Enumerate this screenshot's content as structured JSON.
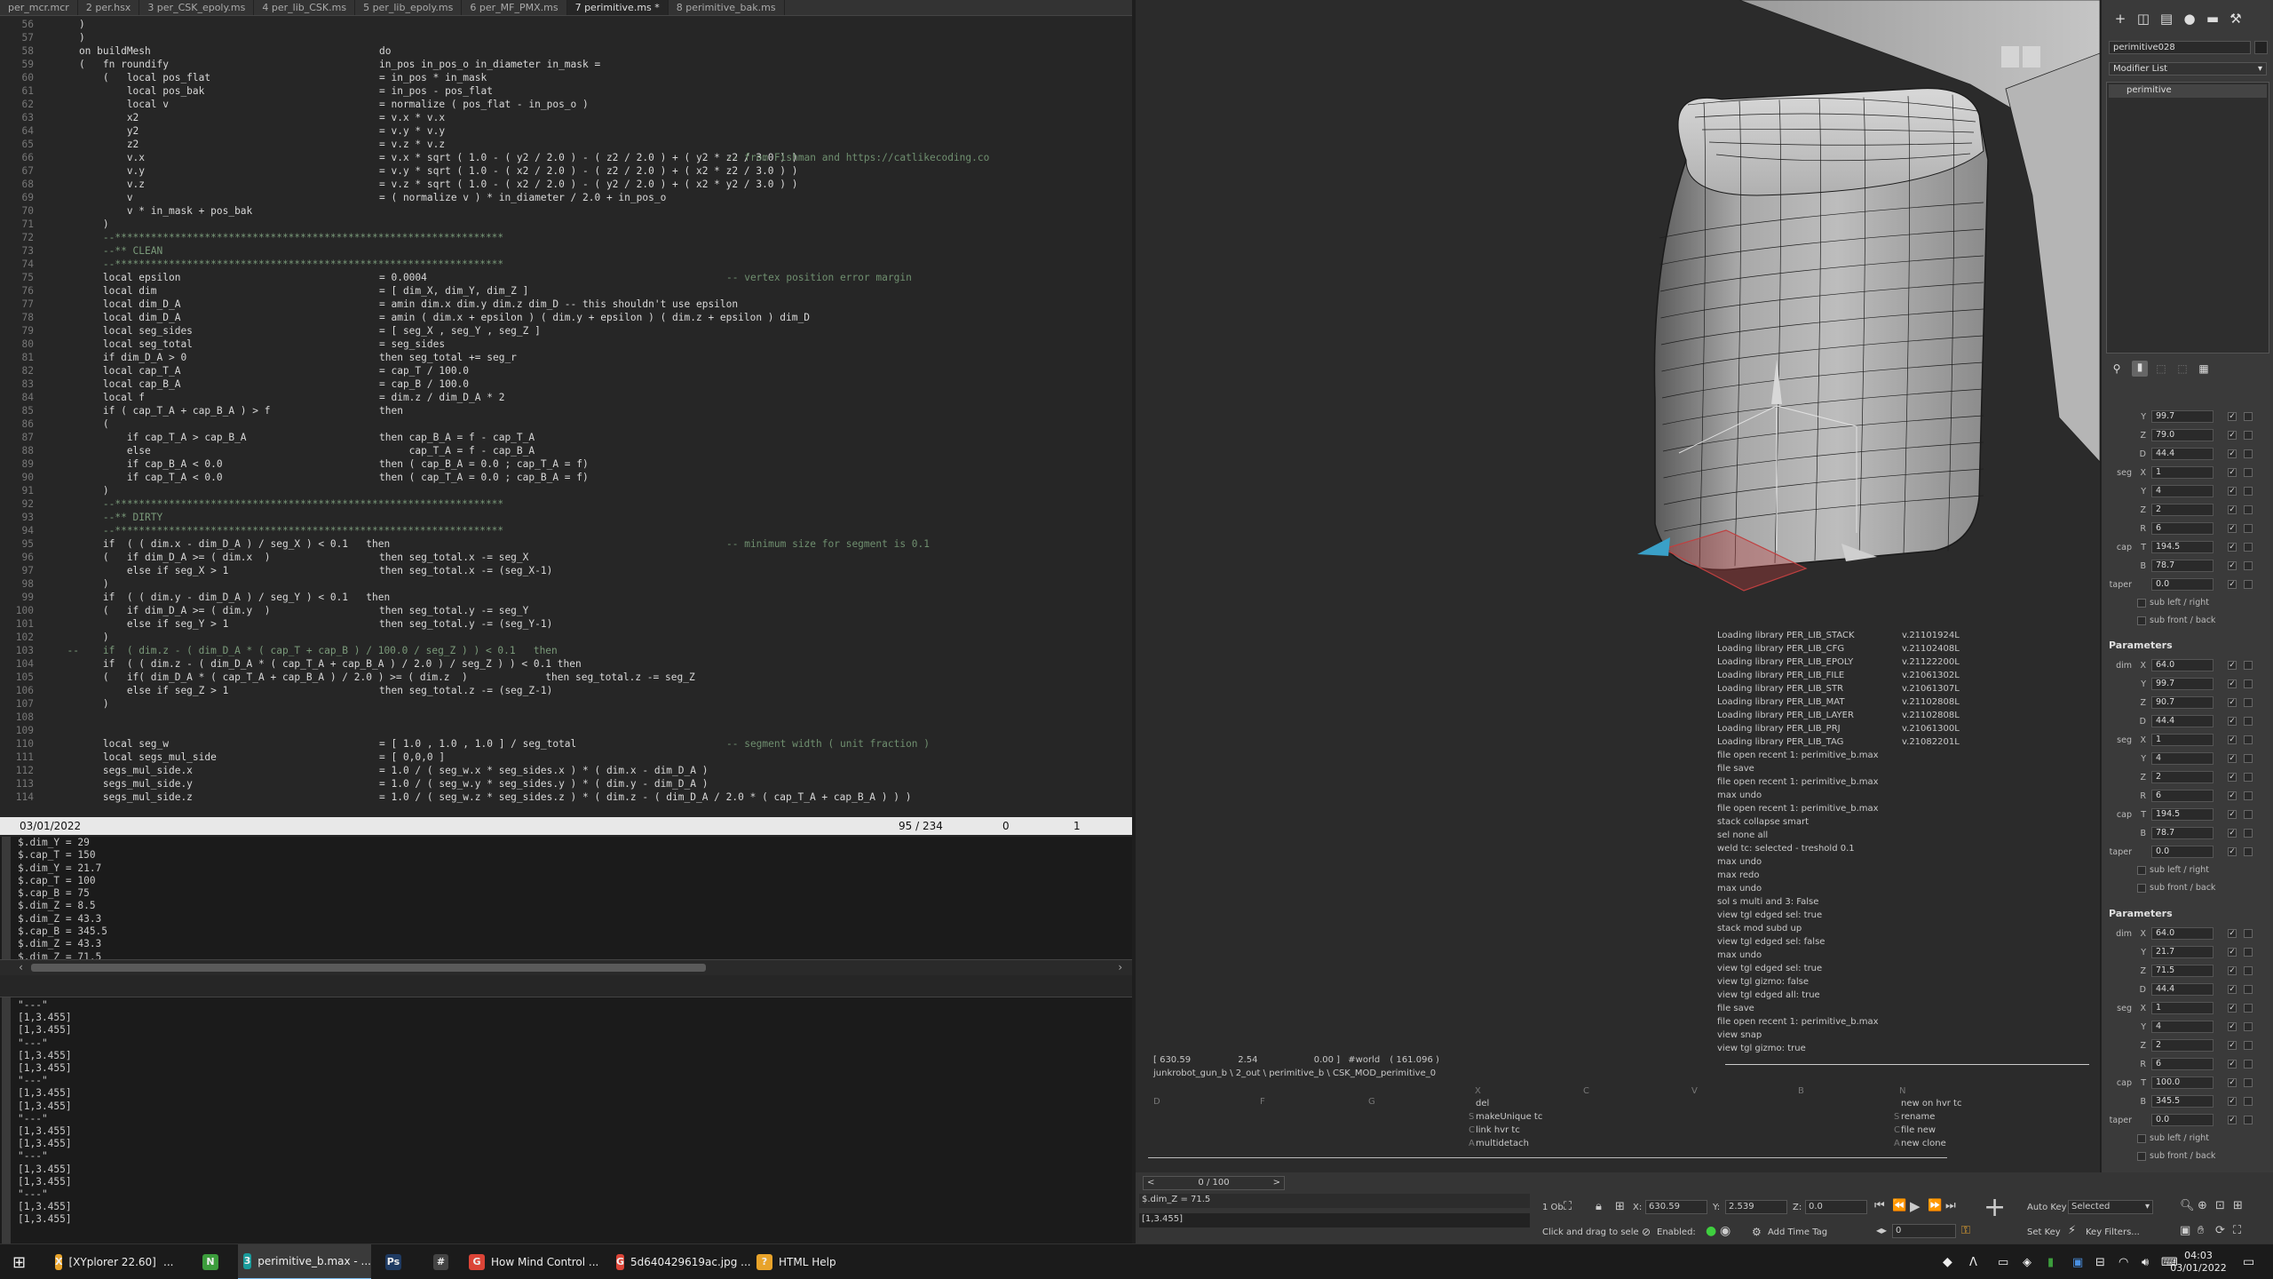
{
  "editor": {
    "tabs": [
      {
        "label": "per_mcr.mcr",
        "active": false
      },
      {
        "label": "2 per.hsx",
        "active": false
      },
      {
        "label": "3 per_CSK_epoly.ms",
        "active": false
      },
      {
        "label": "4 per_lib_CSK.ms",
        "active": false
      },
      {
        "label": "5 per_lib_epoly.ms",
        "active": false
      },
      {
        "label": "6 per_MF_PMX.ms",
        "active": false
      },
      {
        "label": "7 perimitive.ms *",
        "active": true
      },
      {
        "label": "8 perimitive_bak.ms",
        "active": false
      }
    ],
    "lines": [
      {
        "n": "56",
        "t": "    )",
        "r": "",
        "c": ""
      },
      {
        "n": "57",
        "t": "    )",
        "r": "",
        "c": ""
      },
      {
        "n": "58",
        "t": "    on buildMesh",
        "r": "do",
        "c": ""
      },
      {
        "n": "59",
        "t": "    (   fn roundify",
        "r": "in_pos in_pos_o in_diameter in_mask =",
        "c": ""
      },
      {
        "n": "60",
        "t": "        (   local pos_flat",
        "r": "= in_pos * in_mask",
        "c": ""
      },
      {
        "n": "61",
        "t": "            local pos_bak",
        "r": "= in_pos - pos_flat",
        "c": ""
      },
      {
        "n": "62",
        "t": "            local v",
        "r": "= normalize ( pos_flat - in_pos_o )",
        "c": ""
      },
      {
        "n": "63",
        "t": "            x2",
        "r": "= v.x * v.x",
        "c": ""
      },
      {
        "n": "64",
        "t": "            y2",
        "r": "= v.y * v.y",
        "c": ""
      },
      {
        "n": "65",
        "t": "            z2",
        "r": "= v.z * v.z",
        "c": ""
      },
      {
        "n": "66",
        "t": "            v.x",
        "r": "= v.x * sqrt ( 1.0 - ( y2 / 2.0 ) - ( z2 / 2.0 ) + ( y2 * z2 / 3.0 ) )",
        "c": "-- from Fishman and https://catlikecoding.co"
      },
      {
        "n": "67",
        "t": "            v.y",
        "r": "= v.y * sqrt ( 1.0 - ( x2 / 2.0 ) - ( z2 / 2.0 ) + ( x2 * z2 / 3.0 ) )",
        "c": ""
      },
      {
        "n": "68",
        "t": "            v.z",
        "r": "= v.z * sqrt ( 1.0 - ( x2 / 2.0 ) - ( y2 / 2.0 ) + ( x2 * y2 / 3.0 ) )",
        "c": ""
      },
      {
        "n": "69",
        "t": "            v",
        "r": "= ( normalize v ) * in_diameter / 2.0 + in_pos_o",
        "c": ""
      },
      {
        "n": "70",
        "t": "            v * in_mask + pos_bak",
        "r": "",
        "c": ""
      },
      {
        "n": "71",
        "t": "        )",
        "r": "",
        "c": ""
      },
      {
        "n": "72",
        "t": "        --*****************************************************************",
        "r": "",
        "c": ""
      },
      {
        "n": "73",
        "t": "        --** CLEAN",
        "r": "",
        "c": ""
      },
      {
        "n": "74",
        "t": "        --*****************************************************************",
        "r": "",
        "c": ""
      },
      {
        "n": "75",
        "t": "        local epsilon",
        "r": "= 0.0004",
        "c": "-- vertex position error margin"
      },
      {
        "n": "76",
        "t": "        local dim",
        "r": "= [ dim_X, dim_Y, dim_Z ]",
        "c": ""
      },
      {
        "n": "77",
        "t": "        local dim_D_A",
        "r": "= amin dim.x dim.y dim.z dim_D -- this shouldn't use epsilon",
        "c": ""
      },
      {
        "n": "78",
        "t": "        local dim_D_A",
        "r": "= amin ( dim.x + epsilon ) ( dim.y + epsilon ) ( dim.z + epsilon ) dim_D",
        "c": ""
      },
      {
        "n": "79",
        "t": "        local seg_sides",
        "r": "= [ seg_X , seg_Y , seg_Z ]",
        "c": ""
      },
      {
        "n": "80",
        "t": "        local seg_total",
        "r": "= seg_sides",
        "c": ""
      },
      {
        "n": "81",
        "t": "        if dim_D_A > 0",
        "r": "then seg_total += seg_r",
        "c": ""
      },
      {
        "n": "82",
        "t": "        local cap_T_A",
        "r": "= cap_T / 100.0",
        "c": ""
      },
      {
        "n": "83",
        "t": "        local cap_B_A",
        "r": "= cap_B / 100.0",
        "c": ""
      },
      {
        "n": "84",
        "t": "        local f",
        "r": "= dim.z / dim_D_A * 2",
        "c": ""
      },
      {
        "n": "85",
        "t": "        if ( cap_T_A + cap_B_A ) > f",
        "r": "then",
        "c": ""
      },
      {
        "n": "86",
        "t": "        (",
        "r": "",
        "c": ""
      },
      {
        "n": "87",
        "t": "            if cap_T_A > cap_B_A",
        "r": "then cap_B_A = f - cap_T_A",
        "c": ""
      },
      {
        "n": "88",
        "t": "            else",
        "r": "     cap_T_A = f - cap_B_A",
        "c": ""
      },
      {
        "n": "89",
        "t": "            if cap_B_A < 0.0",
        "r": "then ( cap_B_A = 0.0 ; cap_T_A = f)",
        "c": ""
      },
      {
        "n": "90",
        "t": "            if cap_T_A < 0.0",
        "r": "then ( cap_T_A = 0.0 ; cap_B_A = f)",
        "c": ""
      },
      {
        "n": "91",
        "t": "        )",
        "r": "",
        "c": ""
      },
      {
        "n": "92",
        "t": "        --*****************************************************************",
        "r": "",
        "c": ""
      },
      {
        "n": "93",
        "t": "        --** DIRTY",
        "r": "",
        "c": ""
      },
      {
        "n": "94",
        "t": "        --*****************************************************************",
        "r": "",
        "c": ""
      },
      {
        "n": "95",
        "t": "        if  ( ( dim.x - dim_D_A ) / seg_X ) < 0.1   then",
        "r": "",
        "c": "-- minimum size for segment is 0.1"
      },
      {
        "n": "96",
        "t": "        (   if dim_D_A >= ( dim.x  )",
        "r": "then seg_total.x -= seg_X",
        "c": ""
      },
      {
        "n": "97",
        "t": "            else if seg_X > 1",
        "r": "then seg_total.x -= (seg_X-1)",
        "c": ""
      },
      {
        "n": "98",
        "t": "        )",
        "r": "",
        "c": ""
      },
      {
        "n": "99",
        "t": "        if  ( ( dim.y - dim_D_A ) / seg_Y ) < 0.1   then",
        "r": "",
        "c": ""
      },
      {
        "n": "100",
        "t": "        (   if dim_D_A >= ( dim.y  )",
        "r": "then seg_total.y -= seg_Y",
        "c": ""
      },
      {
        "n": "101",
        "t": "            else if seg_Y > 1",
        "r": "then seg_total.y -= (seg_Y-1)",
        "c": ""
      },
      {
        "n": "102",
        "t": "        )",
        "r": "",
        "c": ""
      },
      {
        "n": "103",
        "t": "  --    if  ( dim.z - ( dim_D_A * ( cap_T + cap_B ) / 100.0 / seg_Z ) ) < 0.1   then",
        "r": "",
        "c": ""
      },
      {
        "n": "104",
        "t": "        if  ( ( dim.z - ( dim_D_A * ( cap_T_A + cap_B_A ) / 2.0 ) / seg_Z ) ) < 0.1 then",
        "r": "",
        "c": ""
      },
      {
        "n": "105",
        "t": "        (   if( dim_D_A * ( cap_T_A + cap_B_A ) / 2.0 ) >= ( dim.z  )             then seg_total.z -= seg_Z",
        "r": "",
        "c": ""
      },
      {
        "n": "106",
        "t": "            else if seg_Z > 1",
        "r": "then seg_total.z -= (seg_Z-1)",
        "c": ""
      },
      {
        "n": "107",
        "t": "        )",
        "r": "",
        "c": ""
      },
      {
        "n": "108",
        "t": "",
        "r": "",
        "c": ""
      },
      {
        "n": "109",
        "t": "",
        "r": "",
        "c": ""
      },
      {
        "n": "110",
        "t": "        local seg_w",
        "r": "= [ 1.0 , 1.0 , 1.0 ] / seg_total",
        "c": "-- segment width ( unit fraction )"
      },
      {
        "n": "111",
        "t": "        local segs_mul_side",
        "r": "= [ 0,0,0 ]",
        "c": ""
      },
      {
        "n": "112",
        "t": "        segs_mul_side.x",
        "r": "= 1.0 / ( seg_w.x * seg_sides.x ) * ( dim.x - dim_D_A )",
        "c": ""
      },
      {
        "n": "113",
        "t": "        segs_mul_side.y",
        "r": "= 1.0 / ( seg_w.y * seg_sides.y ) * ( dim.y - dim_D_A )",
        "c": ""
      },
      {
        "n": "114",
        "t": "        segs_mul_side.z",
        "r": "= 1.0 / ( seg_w.z * seg_sides.z ) * ( dim.z - ( dim_D_A / 2.0 * ( cap_T_A + cap_B_A ) ) )",
        "c": ""
      }
    ],
    "status": {
      "date": "03/01/2022",
      "position": "95 / 234",
      "col": "0",
      "sel": "1"
    },
    "listener_top": [
      "$.dim_Y = 29",
      "$.cap_T = 150",
      "$.dim_Y = 21.7",
      "$.cap_T = 100",
      "$.cap_B = 75",
      "$.dim_Z = 8.5",
      "$.dim_Z = 43.3",
      "$.cap_B = 345.5",
      "$.dim_Z = 43.3",
      "$.dim_Z = 71.5"
    ],
    "listener_bottom": [
      "\"---\"",
      "[1,3.455]",
      "[1,3.455]",
      "\"---\"",
      "[1,3.455]",
      "[1,3.455]",
      "\"---\"",
      "[1,3.455]",
      "[1,3.455]",
      "\"---\"",
      "[1,3.455]",
      "[1,3.455]",
      "\"---\"",
      "[1,3.455]",
      "[1,3.455]",
      "\"---\"",
      "[1,3.455]",
      "[1,3.455]"
    ]
  },
  "viewport": {
    "log": [
      {
        "text": "Loading library PER_LIB_STACK",
        "ver": "v.21101924L"
      },
      {
        "text": "Loading library PER_LIB_CFG",
        "ver": "v.21102408L"
      },
      {
        "text": "Loading library PER_LIB_EPOLY",
        "ver": "v.21122200L"
      },
      {
        "text": "Loading library PER_LIB_FILE",
        "ver": "v.21061302L"
      },
      {
        "text": "Loading library PER_LIB_STR",
        "ver": "v.21061307L"
      },
      {
        "text": "Loading library PER_LIB_MAT",
        "ver": "v.21102808L"
      },
      {
        "text": "Loading library PER_LIB_LAYER",
        "ver": "v.21102808L"
      },
      {
        "text": "Loading library PER_LIB_PRJ",
        "ver": "v.21061300L"
      },
      {
        "text": "Loading library PER_LIB_TAG",
        "ver": "v.21082201L"
      },
      {
        "text": "file open recent 1: perimitive_b.max",
        "ver": ""
      },
      {
        "text": "file save",
        "ver": ""
      },
      {
        "text": "file open recent 1: perimitive_b.max",
        "ver": ""
      },
      {
        "text": "max undo",
        "ver": ""
      },
      {
        "text": "file open recent 1: perimitive_b.max",
        "ver": ""
      },
      {
        "text": "stack collapse smart",
        "ver": ""
      },
      {
        "text": "sel none all",
        "ver": ""
      },
      {
        "text": "weld tc: selected - treshold 0.1",
        "ver": ""
      },
      {
        "text": "max undo",
        "ver": ""
      },
      {
        "text": "max redo",
        "ver": ""
      },
      {
        "text": "max undo",
        "ver": ""
      },
      {
        "text": "sol s multi and 3: False",
        "ver": ""
      },
      {
        "text": "view tgl edged sel: true",
        "ver": ""
      },
      {
        "text": "stack mod subd up",
        "ver": ""
      },
      {
        "text": "view tgl edged sel: false",
        "ver": ""
      },
      {
        "text": "max undo",
        "ver": ""
      },
      {
        "text": "view tgl edged sel: true",
        "ver": ""
      },
      {
        "text": "view tgl gizmo: false",
        "ver": ""
      },
      {
        "text": "view tgl edged all: true",
        "ver": ""
      },
      {
        "text": "file save",
        "ver": ""
      },
      {
        "text": "file open recent 1: perimitive_b.max",
        "ver": ""
      },
      {
        "text": "view snap",
        "ver": ""
      },
      {
        "text": "view tgl gizmo: true",
        "ver": ""
      }
    ],
    "coord_x": "[ 630.59",
    "coord_y": "2.54",
    "coord_z": "0.00 ]",
    "coord_space": "#world",
    "coord_len": "( 161.096 )",
    "path": "junkrobot_gun_b \\ 2_out \\ perimitive_b \\ CSK_MOD_perimitive_0",
    "hotkey_headers": [
      "X",
      "C",
      "V",
      "B",
      "N",
      "D",
      "F",
      "G"
    ],
    "hotkeys_left": [
      "del",
      "makeUnique tc",
      "link hvr tc",
      "multidetach"
    ],
    "hotkeys_left_keys": [
      "",
      "S",
      "C",
      "A"
    ],
    "hotkeys_right": [
      "new on hvr tc",
      "rename",
      "file new",
      "new clone"
    ],
    "hotkeys_right_keys": [
      "",
      "S",
      "C",
      "A"
    ]
  },
  "command_panel": {
    "object_name": "perimitive028",
    "modifier_list": "Modifier List",
    "stack_item": "perimitive",
    "section_title": "Parameters",
    "group1": [
      {
        "label": "Y",
        "value": "99.7"
      },
      {
        "label": "Z",
        "value": "79.0"
      },
      {
        "label": "D",
        "value": "44.4"
      },
      {
        "label": "X",
        "value": "1",
        "prefix": "seg"
      },
      {
        "label": "Y",
        "value": "4"
      },
      {
        "label": "Z",
        "value": "2"
      },
      {
        "label": "R",
        "value": "6"
      },
      {
        "label": "T",
        "value": "194.5",
        "prefix": "cap"
      },
      {
        "label": "B",
        "value": "78.7"
      },
      {
        "label": "",
        "value": "0.0",
        "prefix": "taper"
      }
    ],
    "group2": [
      {
        "label": "X",
        "value": "64.0",
        "prefix": "dim"
      },
      {
        "label": "Y",
        "value": "99.7"
      },
      {
        "label": "Z",
        "value": "90.7"
      },
      {
        "label": "D",
        "value": "44.4"
      },
      {
        "label": "X",
        "value": "1",
        "prefix": "seg"
      },
      {
        "label": "Y",
        "value": "4"
      },
      {
        "label": "Z",
        "value": "2"
      },
      {
        "label": "R",
        "value": "6"
      },
      {
        "label": "T",
        "value": "194.5",
        "prefix": "cap"
      },
      {
        "label": "B",
        "value": "78.7"
      },
      {
        "label": "",
        "value": "0.0",
        "prefix": "taper"
      }
    ],
    "group3": [
      {
        "label": "X",
        "value": "64.0",
        "prefix": "dim"
      },
      {
        "label": "Y",
        "value": "21.7"
      },
      {
        "label": "Z",
        "value": "71.5"
      },
      {
        "label": "D",
        "value": "44.4"
      },
      {
        "label": "X",
        "value": "1",
        "prefix": "seg"
      },
      {
        "label": "Y",
        "value": "4"
      },
      {
        "label": "Z",
        "value": "2"
      },
      {
        "label": "R",
        "value": "6"
      },
      {
        "label": "T",
        "value": "100.0",
        "prefix": "cap"
      },
      {
        "label": "B",
        "value": "345.5"
      },
      {
        "label": "",
        "value": "0.0",
        "prefix": "taper"
      }
    ],
    "sub_left_right": "sub left / right",
    "sub_front_back": "sub front / back"
  },
  "bottom": {
    "frame": "0 / 100",
    "prev": "<",
    "next": ">",
    "mini_listener_top": "$.dim_Z = 71.5",
    "mini_listener_bottom": "[1,3.455]",
    "selected_count": "1 Ob",
    "x_label": "X:",
    "x_value": "630.59",
    "y_label": "Y:",
    "y_value": "2.539",
    "z_label": "Z:",
    "z_value": "0.0",
    "hint": "Click and drag to sele",
    "enabled": "Enabled:",
    "add_time_tag": "Add Time Tag",
    "auto_key": "Auto Key",
    "set_key": "Set Key",
    "selected": "Selected",
    "key_filters": "Key Filters...",
    "frame_value": "0"
  },
  "taskbar": {
    "items": [
      {
        "label": "[XYplorer 22.60]",
        "icon": "X",
        "color": "#e8a32a"
      },
      {
        "label": "...",
        "icon": "",
        "color": ""
      },
      {
        "label": "",
        "icon": "N",
        "color": "#3c9d3c"
      },
      {
        "label": "perimitive_b.max - ...",
        "icon": "3",
        "color": "#1a9c9c"
      },
      {
        "label": "",
        "icon": "Ps",
        "color": "#1f3b63"
      },
      {
        "label": "",
        "icon": "#",
        "color": "#444"
      },
      {
        "label": "How Mind Control ...",
        "icon": "G",
        "color": "#db4437"
      },
      {
        "label": "5d640429619ac.jpg ...",
        "icon": "G",
        "color": "#db4437"
      },
      {
        "label": "HTML Help",
        "icon": "?",
        "color": "#e8a32a"
      }
    ],
    "time": "04:03",
    "date": "03/01/2022"
  }
}
